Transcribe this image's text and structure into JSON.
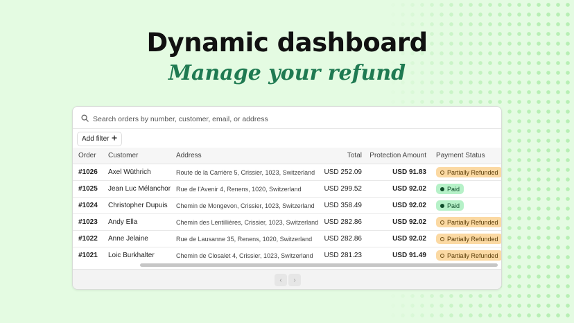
{
  "hero": {
    "title": "Dynamic dashboard",
    "subtitle": "Manage your refund"
  },
  "search": {
    "placeholder": "Search orders by number, customer, email, or address",
    "icon": "search-icon"
  },
  "filter": {
    "label": "Add filter",
    "icon": "plus-icon"
  },
  "table": {
    "columns": [
      "Order",
      "Customer",
      "Address",
      "Total",
      "Protection Amount",
      "Payment Status"
    ],
    "rows": [
      {
        "order": "#1026",
        "customer": "Axel Wüthrich",
        "address": "Route de la Carrière 5, Crissier, 1023, Switzerland",
        "total": "USD 252.09",
        "protection": "USD 91.83",
        "status": "Partially Refunded",
        "status_type": "refund"
      },
      {
        "order": "#1025",
        "customer": "Jean Luc Mélanchon",
        "address": "Rue de l'Avenir 4, Renens, 1020, Switzerland",
        "total": "USD 299.52",
        "protection": "USD 92.02",
        "status": "Paid",
        "status_type": "paid"
      },
      {
        "order": "#1024",
        "customer": "Christopher Dupuis",
        "address": "Chemin de Mongevon, Crissier, 1023, Switzerland",
        "total": "USD 358.49",
        "protection": "USD 92.02",
        "status": "Paid",
        "status_type": "paid"
      },
      {
        "order": "#1023",
        "customer": "Andy Ella",
        "address": "Chemin des Lentillières, Crissier, 1023, Switzerland",
        "total": "USD 282.86",
        "protection": "USD 92.02",
        "status": "Partially Refunded",
        "status_type": "refund"
      },
      {
        "order": "#1022",
        "customer": "Anne Jelaine",
        "address": "Rue de Lausanne 35, Renens, 1020, Switzerland",
        "total": "USD 282.86",
        "protection": "USD 92.02",
        "status": "Partially Refunded",
        "status_type": "refund"
      },
      {
        "order": "#1021",
        "customer": "Loic Burkhalter",
        "address": "Chemin de Closalet 4, Crissier, 1023, Switzerland",
        "total": "USD 281.23",
        "protection": "USD 91.49",
        "status": "Partially Refunded",
        "status_type": "refund"
      }
    ]
  },
  "pagination": {
    "prev_icon": "chevron-left-icon",
    "next_icon": "chevron-right-icon",
    "prev_glyph": "‹",
    "next_glyph": "›"
  },
  "colors": {
    "background": "#e4fbe2",
    "accent": "#1f7a52",
    "refund_badge": "#fbd9a3",
    "paid_badge": "#b6f1c8"
  }
}
